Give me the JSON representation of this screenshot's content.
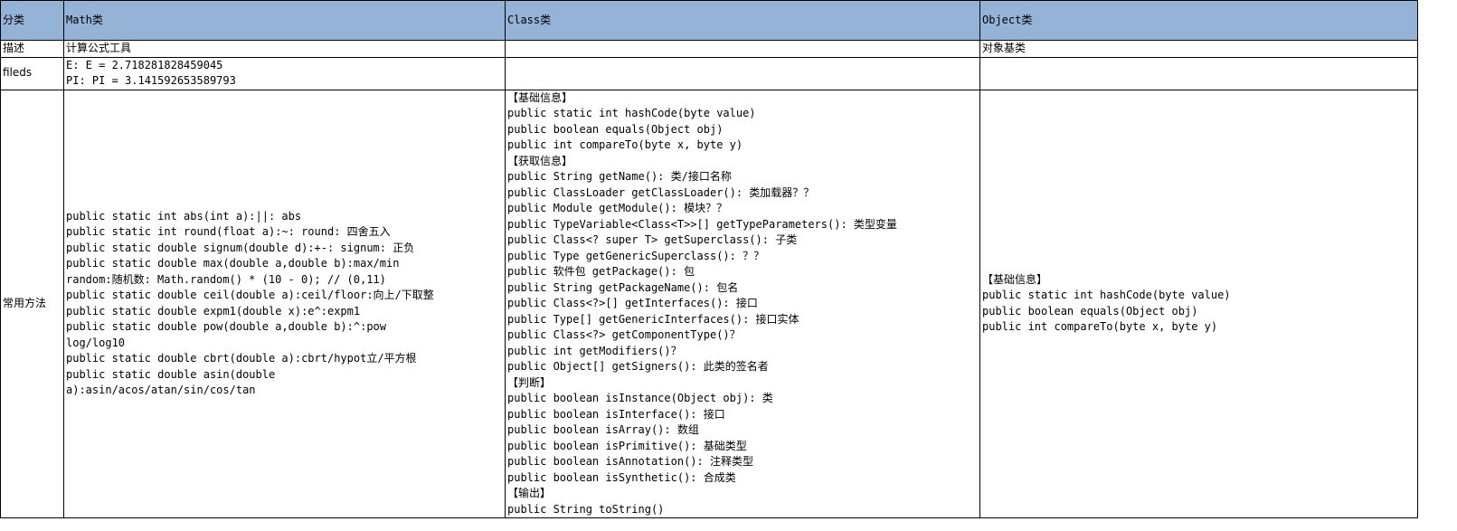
{
  "header": {
    "col0": "分类",
    "col1": "Math类",
    "col2": "Class类",
    "col3": "Object类"
  },
  "rows": {
    "desc": {
      "label": "描述",
      "math": "计算公式工具",
      "class": "",
      "object": "对象基类"
    },
    "fields": {
      "label": "fileds",
      "math": [
        "E: E = 2.718281828459045",
        "PI: PI = 3.141592653589793"
      ],
      "class": "",
      "object": ""
    },
    "methods": {
      "label": "常用方法",
      "math": [
        "public static int abs(int a):||: abs",
        "public static int round(float a):~: round: 四舍五入",
        "public static double signum(double d):+-: signum: 正负",
        "public static double max(double a,double b):max/min",
        "random:随机数: Math.random() * (10 - 0); // (0,11)",
        "public static double ceil(double a):ceil/floor:向上/下取整",
        "public static double expm1(double x):e^:expm1",
        "public static double pow(double a,double b):^:pow",
        "log/log10",
        "public static double cbrt(double a):cbrt/hypot立/平方根",
        "public static double asin(double",
        "a):asin/acos/atan/sin/cos/tan"
      ],
      "class": [
        "【基础信息】",
        "public static int hashCode(byte value)",
        "public boolean equals(Object obj)",
        "public int compareTo(byte x, byte y)",
        "【获取信息】",
        "public String getName(): 类/接口名称",
        "public ClassLoader getClassLoader(): 类加载器？？",
        "public Module getModule(): 模块？？",
        "public TypeVariable<Class<T>>[] getTypeParameters(): 类型变量",
        "public Class<? super T> getSuperclass(): 子类",
        "public Type getGenericSuperclass(): ？？",
        "public 软件包 getPackage(): 包",
        "public String getPackageName(): 包名",
        "public Class<?>[] getInterfaces(): 接口",
        "public Type[] getGenericInterfaces(): 接口实体",
        "public Class<?> getComponentType()？",
        "public int getModifiers()？",
        "public Object[] getSigners(): 此类的签名者",
        "【判断】",
        "public boolean isInstance(Object obj): 类",
        "public boolean isInterface(): 接口",
        "public boolean isArray(): 数组",
        "public boolean isPrimitive(): 基础类型",
        "public boolean isAnnotation(): 注释类型",
        "public boolean isSynthetic(): 合成类",
        "【输出】",
        "public String toString()"
      ],
      "object": [
        "【基础信息】",
        "public static int hashCode(byte value)",
        "public boolean equals(Object obj)",
        "public int compareTo(byte x, byte y)"
      ]
    }
  }
}
